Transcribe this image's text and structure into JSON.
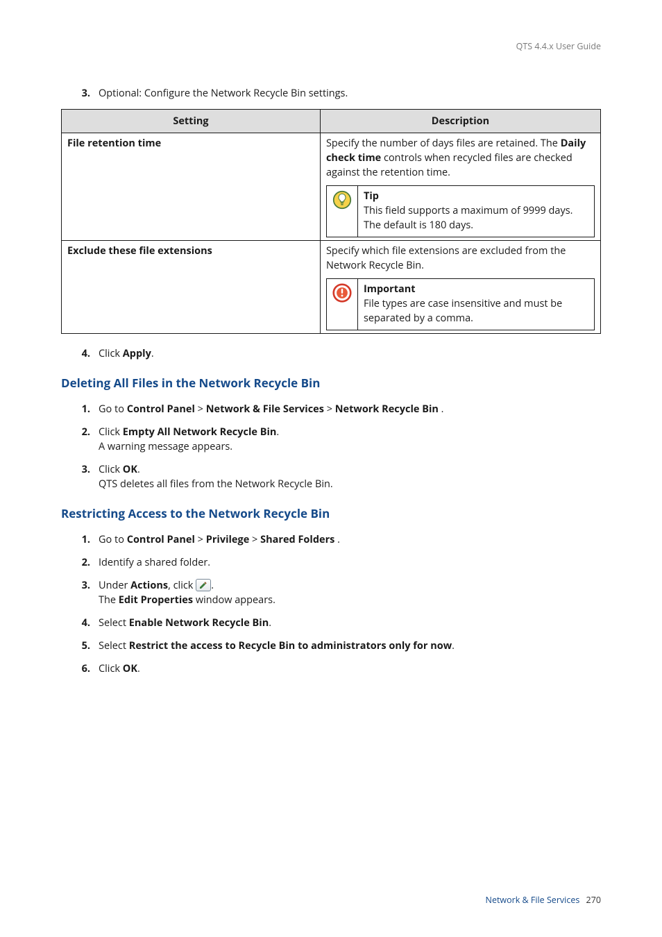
{
  "header": {
    "guide_title": "QTS 4.4.x User Guide"
  },
  "intro_step": {
    "num": "3.",
    "text": "Optional: Configure the Network Recycle Bin settings."
  },
  "table": {
    "headers": {
      "setting": "Setting",
      "description": "Description"
    },
    "rows": [
      {
        "setting": "File retention time",
        "desc_pre": "Specify the number of days files are retained. The ",
        "desc_bold": "Daily check time",
        "desc_post": " controls when recycled files are checked against the retention time.",
        "callout": {
          "type": "tip",
          "title": "Tip",
          "body": "This field supports a maximum of 9999 days. The default is 180 days."
        }
      },
      {
        "setting": "Exclude these file extensions",
        "desc": "Specify which file extensions are excluded from the Network Recycle Bin.",
        "callout": {
          "type": "important",
          "title": "Important",
          "body": "File types are case insensitive and must be separated by a comma."
        }
      }
    ]
  },
  "apply_step": {
    "num": "4.",
    "pre": "Click ",
    "bold": "Apply",
    "post": "."
  },
  "section_delete": {
    "title": "Deleting All Files in the Network Recycle Bin",
    "steps": [
      {
        "num": "1.",
        "parts": [
          "Go to ",
          {
            "b": "Control Panel"
          },
          " > ",
          {
            "b": "Network & File Services"
          },
          " > ",
          {
            "b": "Network Recycle Bin"
          },
          " ."
        ]
      },
      {
        "num": "2.",
        "parts": [
          "Click ",
          {
            "b": "Empty All Network Recycle Bin"
          },
          "."
        ],
        "sub": "A warning message appears."
      },
      {
        "num": "3.",
        "parts": [
          "Click ",
          {
            "b": "OK"
          },
          "."
        ],
        "sub": "QTS deletes all files from the Network Recycle Bin."
      }
    ]
  },
  "section_restrict": {
    "title": "Restricting Access to the Network Recycle Bin",
    "steps": [
      {
        "num": "1.",
        "parts": [
          "Go to ",
          {
            "b": "Control Panel"
          },
          " > ",
          {
            "b": "Privilege"
          },
          " > ",
          {
            "b": "Shared Folders"
          },
          " ."
        ]
      },
      {
        "num": "2.",
        "parts": [
          "Identify a shared folder."
        ]
      },
      {
        "num": "3.",
        "parts": [
          "Under ",
          {
            "b": "Actions"
          },
          ", click ",
          {
            "icon": "edit-properties-icon"
          },
          "."
        ],
        "sub_parts": [
          "The ",
          {
            "b": "Edit Properties"
          },
          " window appears."
        ]
      },
      {
        "num": "4.",
        "parts": [
          "Select ",
          {
            "b": "Enable Network Recycle Bin"
          },
          "."
        ]
      },
      {
        "num": "5.",
        "parts": [
          "Select ",
          {
            "b": "Restrict the access to Recycle Bin to administrators only for now"
          },
          "."
        ]
      },
      {
        "num": "6.",
        "parts": [
          "Click ",
          {
            "b": "OK"
          },
          "."
        ]
      }
    ]
  },
  "footer": {
    "section": "Network & File Services",
    "page": "270"
  },
  "icons": {
    "tip": "lightbulb-icon",
    "important": "alert-icon",
    "edit": "edit-properties-icon"
  }
}
